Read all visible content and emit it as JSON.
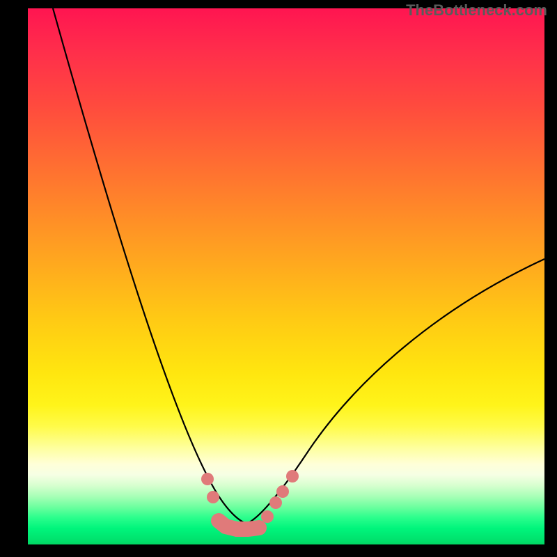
{
  "watermark": "TheBottleneck.com",
  "colors": {
    "gradient_top": "#ff1551",
    "gradient_mid": "#ffe60f",
    "gradient_bottom": "#00d763",
    "curve": "#000000",
    "markers": "#e07a7a",
    "frame": "#000000",
    "watermark_text": "#5b5b5b"
  },
  "chart_data": {
    "type": "line",
    "title": "",
    "xlabel": "",
    "ylabel": "",
    "xlim": [
      0,
      1
    ],
    "ylim": [
      0,
      1
    ],
    "legend": null,
    "background_meaning": "vertical gradient red→yellow→green indicating bottleneck severity (high at top, low at bottom)",
    "series": [
      {
        "name": "bottleneck-curve",
        "x": [
          0.05,
          0.1,
          0.15,
          0.2,
          0.25,
          0.3,
          0.35,
          0.38,
          0.41,
          0.45,
          0.5,
          0.55,
          0.65,
          0.8,
          1.0
        ],
        "y": [
          1.0,
          0.78,
          0.58,
          0.4,
          0.24,
          0.14,
          0.07,
          0.04,
          0.03,
          0.04,
          0.09,
          0.16,
          0.29,
          0.42,
          0.53
        ]
      }
    ],
    "markers": {
      "name": "highlighted-points",
      "x": [
        0.35,
        0.36,
        0.37,
        0.385,
        0.41,
        0.43,
        0.465,
        0.48,
        0.49,
        0.51
      ],
      "y": [
        0.12,
        0.09,
        0.05,
        0.035,
        0.03,
        0.03,
        0.035,
        0.06,
        0.08,
        0.1
      ]
    }
  }
}
